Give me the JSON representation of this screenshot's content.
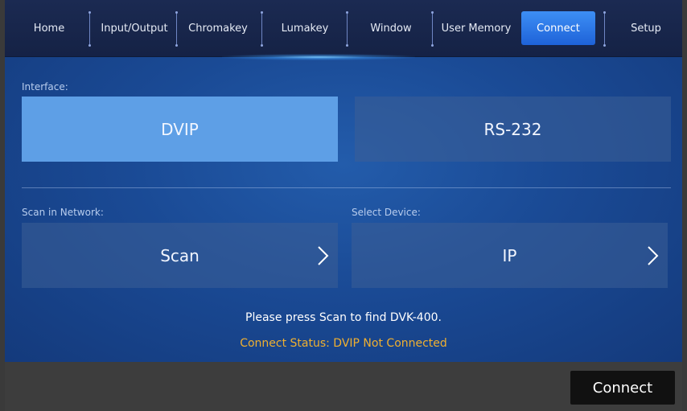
{
  "nav": {
    "tabs": [
      {
        "label": "Home"
      },
      {
        "label": "Input/Output"
      },
      {
        "label": "Chromakey"
      },
      {
        "label": "Lumakey"
      },
      {
        "label": "Window"
      },
      {
        "label": "User Memory"
      },
      {
        "label": "Connect",
        "active": true
      },
      {
        "label": "Setup"
      }
    ]
  },
  "interface": {
    "label": "Interface:",
    "options": [
      {
        "label": "DVIP",
        "selected": true
      },
      {
        "label": "RS-232",
        "selected": false
      }
    ]
  },
  "scan": {
    "label": "Scan in Network:",
    "button": "Scan"
  },
  "device": {
    "label": "Select Device:",
    "button": "IP"
  },
  "messages": {
    "hint": "Please press Scan to find DVK-400.",
    "status": "Connect Status: DVIP Not Connected"
  },
  "footer": {
    "connect_label": "Connect"
  },
  "colors": {
    "accent": "#3d8ff5",
    "selected_option": "#5e9fe6",
    "status_text": "#f0b030"
  }
}
